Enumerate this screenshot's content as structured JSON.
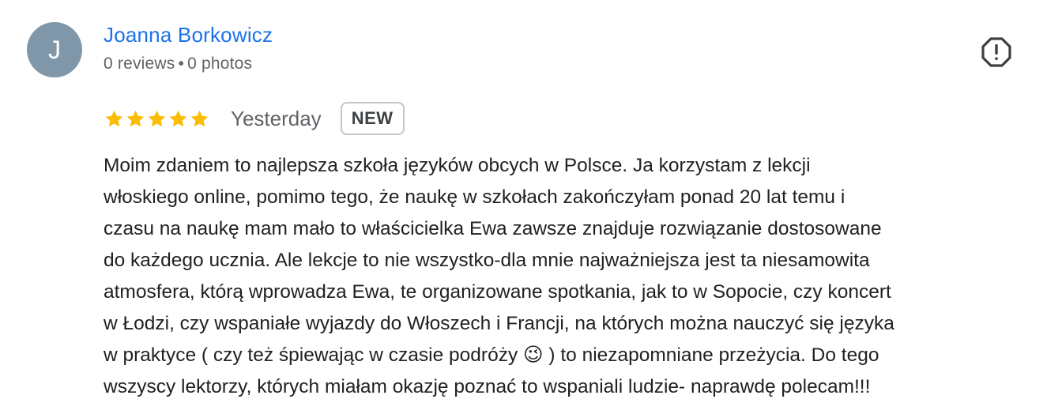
{
  "review": {
    "author": {
      "initial": "J",
      "avatar_color": "#7f97a8",
      "name": "Joanna Borkowicz",
      "reviews": "0 reviews",
      "separator": "•",
      "photos": "0 photos"
    },
    "report_icon": "report-flag-icon",
    "rating": {
      "stars": 5,
      "max_stars": 5,
      "star_color": "#fbbc04"
    },
    "date": "Yesterday",
    "badge": "NEW",
    "text_lines": [
      "Moim zdaniem to najlepsza szkoła języków obcych w Polsce. Ja korzystam z lekcji",
      "włoskiego online, pomimo tego, że naukę w szkołach zakończyłam ponad 20 lat temu i",
      "czasu na naukę mam mało to właścicielka Ewa zawsze znajduje rozwiązanie dostosowane",
      "do każdego ucznia. Ale lekcje to nie wszystko-dla mnie najważniejsza jest ta niesamowita",
      "atmosfera, którą wprowadza Ewa, te organizowane spotkania, jak to w Sopocie, czy koncert",
      "w Łodzi, czy wspaniałe wyjazdy do Włoszech i Francji, na których można nauczyć się języka",
      "w praktyce ( czy też śpiewając w czasie podróży 😉 ) to niezapomniane przeżycia. Do tego",
      "wszyscy lektorzy, których miałam okazję poznać to wspaniali ludzie- naprawdę polecam!!!"
    ]
  }
}
